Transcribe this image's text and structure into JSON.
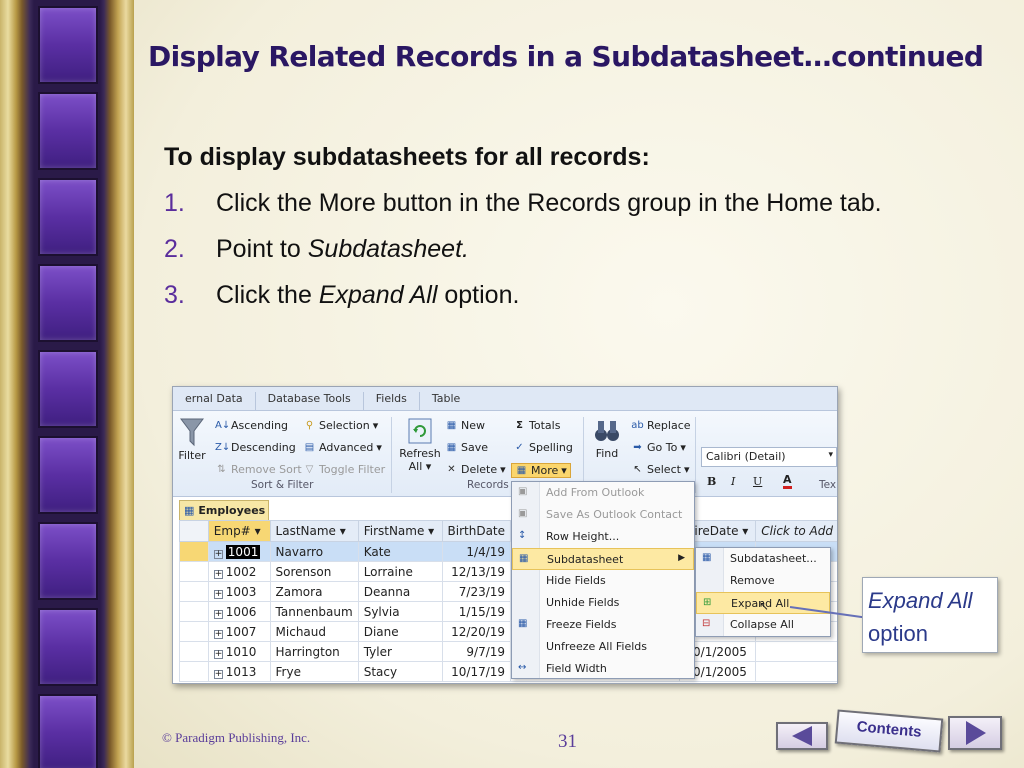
{
  "slide": {
    "title": "Display Related Records in a Subdatasheet…continued",
    "lead": "To display subdatasheets for all records:",
    "steps": [
      {
        "num": "1.",
        "text": "Click the More button in the Records group in the Home tab."
      },
      {
        "num": "2.",
        "pre": "Point to ",
        "em": "Subdatasheet.",
        "post": ""
      },
      {
        "num": "3.",
        "pre": "Click the ",
        "em": "Expand All",
        "post": " option."
      }
    ],
    "copyright": "© Paradigm Publishing, Inc.",
    "page_number": "31",
    "contents_label": "Contents"
  },
  "callout": {
    "em": "Expand All",
    "text": "option"
  },
  "access": {
    "tabs": [
      "ernal Data",
      "Database Tools",
      "Fields",
      "Table"
    ],
    "sort_filter": {
      "filter": "Filter",
      "ascending": "Ascending",
      "descending": "Descending",
      "remove_sort": "Remove Sort",
      "selection": "Selection",
      "advanced": "Advanced",
      "toggle_filter": "Toggle Filter",
      "group_label": "Sort & Filter"
    },
    "records": {
      "refresh": "Refresh",
      "refresh_all": "All",
      "new": "New",
      "save": "Save",
      "delete": "Delete",
      "totals": "Totals",
      "spelling": "Spelling",
      "more": "More",
      "group_label": "Records"
    },
    "find": {
      "find": "Find",
      "replace": "Replace",
      "go_to": "Go To",
      "select": "Select"
    },
    "text_formatting": {
      "font": "Calibri (Detail)",
      "bold": "B",
      "italic": "I",
      "underline": "U",
      "font_color": "A",
      "group_label": "Tex"
    },
    "table_tab": "Employees",
    "columns": [
      "Emp#",
      "LastName",
      "FirstName",
      "BirthDate",
      "HireDate",
      "Click to Add"
    ],
    "rows": [
      {
        "emp": "1001",
        "last": "Navarro",
        "first": "Kate",
        "birth": "1/4/19"
      },
      {
        "emp": "1002",
        "last": "Sorenson",
        "first": "Lorraine",
        "birth": "12/13/19"
      },
      {
        "emp": "1003",
        "last": "Zamora",
        "first": "Deanna",
        "birth": "7/23/19"
      },
      {
        "emp": "1006",
        "last": "Tannenbaum",
        "first": "Sylvia",
        "birth": "1/15/19"
      },
      {
        "emp": "1007",
        "last": "Michaud",
        "first": "Diane",
        "birth": "12/20/19"
      },
      {
        "emp": "1010",
        "last": "Harrington",
        "first": "Tyler",
        "birth": "9/7/19",
        "hire": "10/1/2005"
      },
      {
        "emp": "1013",
        "last": "Frye",
        "first": "Stacy",
        "birth": "10/17/19",
        "hire": "10/1/2005"
      }
    ],
    "more_menu": [
      {
        "label": "Add From Outlook",
        "disabled": true
      },
      {
        "label": "Save As Outlook Contact",
        "disabled": true
      },
      {
        "label": "Row Height..."
      },
      {
        "label": "Subdatasheet",
        "submenu": true
      },
      {
        "label": "Hide Fields"
      },
      {
        "label": "Unhide Fields"
      },
      {
        "label": "Freeze Fields"
      },
      {
        "label": "Unfreeze All Fields"
      },
      {
        "label": "Field Width"
      }
    ],
    "subdatasheet_menu": [
      {
        "label": "Subdatasheet..."
      },
      {
        "label": "Remove"
      },
      {
        "label": "Expand All"
      },
      {
        "label": "Collapse All"
      }
    ]
  },
  "colors": {
    "title": "#2a1763",
    "accent_purple": "#5a2d9c",
    "menu_highlight": "#fde9a3"
  }
}
